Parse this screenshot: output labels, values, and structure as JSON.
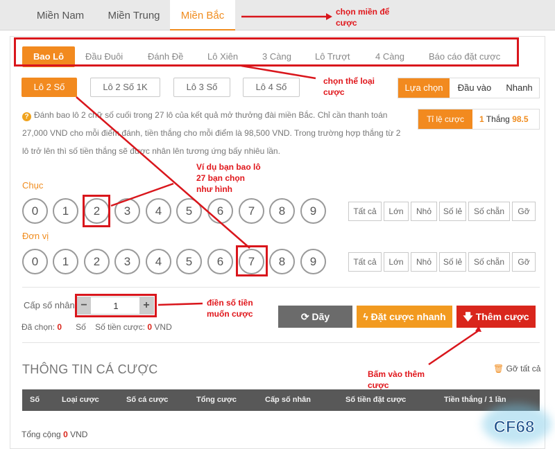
{
  "region_tabs": [
    "Miền Nam",
    "Miền Trung",
    "Miền Bắc"
  ],
  "bet_types": [
    "Bao Lô",
    "Đầu Đuôi",
    "Đánh Đề",
    "Lô Xiên",
    "3 Càng",
    "Lô Trượt",
    "4 Càng",
    "Báo cáo đặt cược"
  ],
  "sub_types": [
    "Lô 2 Số",
    "Lô 2 Số 1K",
    "Lô 3 Số",
    "Lô 4 Số"
  ],
  "modes": [
    "Lựa chọn",
    "Đầu vào",
    "Nhanh"
  ],
  "description": {
    "line1": "Đánh bao lô 2 chữ số cuối trong 27 lô của kết quả mở thưởng đài miền Bắc. Chỉ cần thanh toán",
    "line2": "27,000 VND cho mỗi điểm đánh, tiền thắng cho mỗi điểm là 98,500 VND. Trong trường hợp thắng từ 2",
    "line3": "lô trở lên thì số tiền thắng sẽ được nhân lên tương ứng bấy nhiêu lần.",
    "icon": "question-icon"
  },
  "odds": {
    "label": "Tỉ lệ cược",
    "prefix": "1",
    "text": "Thắng",
    "value": "98.5"
  },
  "rows": [
    {
      "label": "Chục",
      "digits": [
        "0",
        "1",
        "2",
        "3",
        "4",
        "5",
        "6",
        "7",
        "8",
        "9"
      ]
    },
    {
      "label": "Đơn vị",
      "digits": [
        "0",
        "1",
        "2",
        "3",
        "4",
        "5",
        "6",
        "7",
        "8",
        "9"
      ]
    }
  ],
  "filters": [
    "Tất cả",
    "Lớn",
    "Nhỏ",
    "Số lẻ",
    "Số chẵn",
    "Gỡ"
  ],
  "multiplier": {
    "label": "Cấp số nhân",
    "minus": "−",
    "plus": "+",
    "value": "1"
  },
  "selected": {
    "label": "Đã chọn:",
    "count": "0",
    "unit": "Số",
    "amount_label": "Số tiền cược:",
    "amount": "0",
    "currency": "VND"
  },
  "actions": {
    "row": "Dãy",
    "quick": "Đặt cược nhanh",
    "add": "Thêm cược"
  },
  "bet_info": {
    "title": "THÔNG TIN CÁ CƯỢC",
    "clear_all": "Gỡ tất cả",
    "columns": [
      "Số",
      "Loại cược",
      "Số cá cược",
      "Tổng cược",
      "Cấp số nhân",
      "Số tiền đặt cược",
      "Tiền thắng / 1 lần"
    ],
    "total_label": "Tổng cộng",
    "total_value": "0",
    "total_currency": "VND"
  },
  "annotations": {
    "region": "chọn miền để cược",
    "bet_type": "chọn thể loại cược",
    "example_line1": "Ví dụ bạn bao lô",
    "example_line2": "27  bạn chọn",
    "example_line3": "như hình",
    "amount_line1": "điền số tiền",
    "amount_line2": "muốn cược",
    "add_line1": "Bấm vào thêm",
    "add_line2": "cược"
  },
  "logo_text": "CF68",
  "colors": {
    "accent": "#f28a1f",
    "annotation_red": "#e0161b",
    "add_button": "#d9261c",
    "quick_button": "#f29a1f",
    "row_button": "#6b6b6b"
  }
}
